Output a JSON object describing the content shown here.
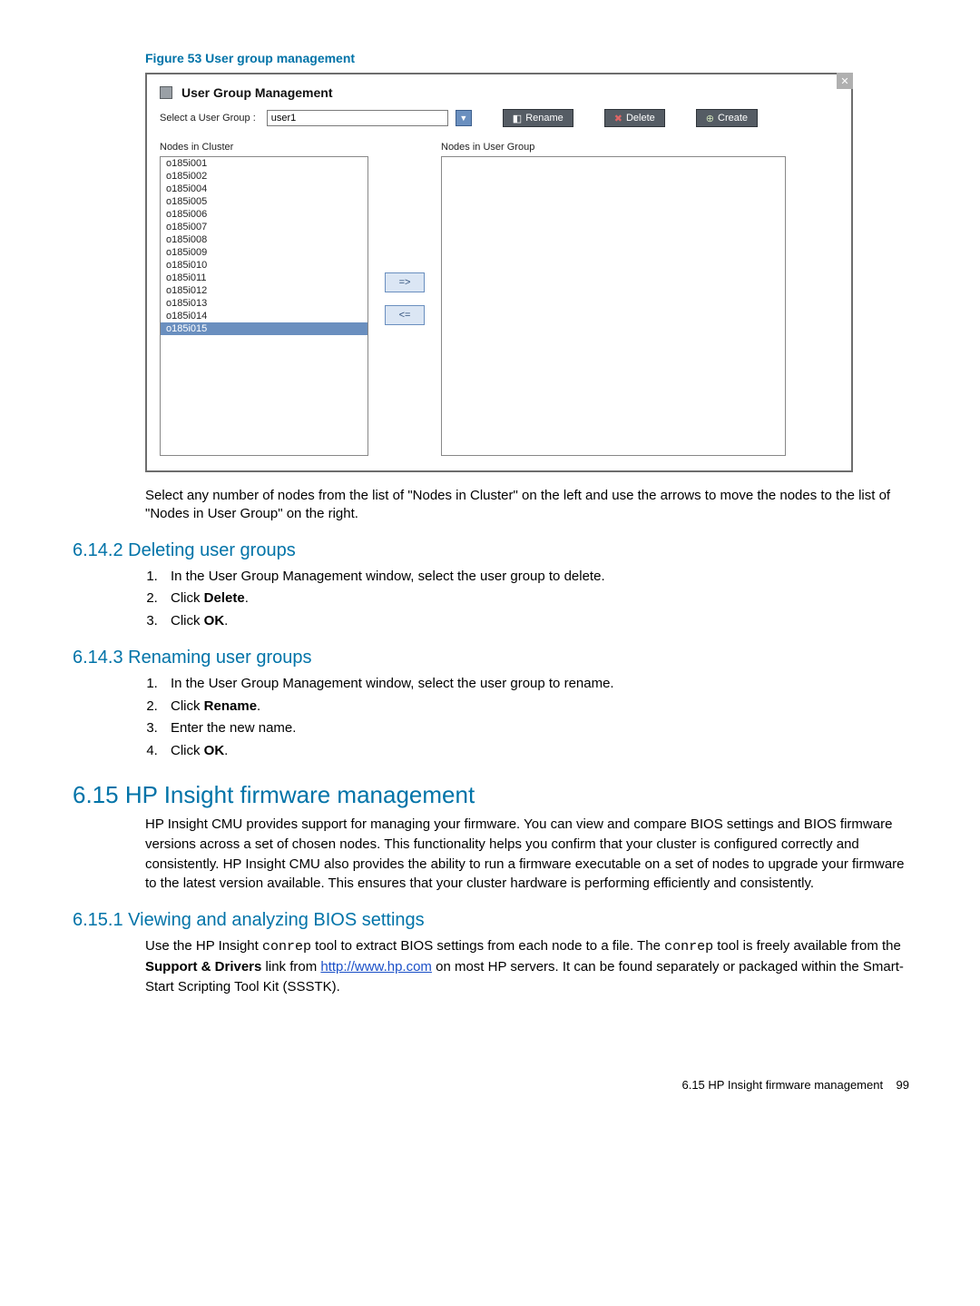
{
  "figure_caption": "Figure 53 User group management",
  "dialog": {
    "title": "User Group Management",
    "close_glyph": "✕",
    "select_label": "Select a User Group :",
    "select_value": "user1",
    "dropdown_arrow": "▼",
    "buttons": {
      "rename": {
        "icon": "◧",
        "label": "Rename"
      },
      "delete": {
        "icon": "✖",
        "label": "Delete"
      },
      "create": {
        "icon": "⊕",
        "label": "Create"
      }
    },
    "left_label": "Nodes in Cluster",
    "right_label": "Nodes in User Group",
    "nodes": [
      "o185i001",
      "o185i002",
      "o185i004",
      "o185i005",
      "o185i006",
      "o185i007",
      "o185i008",
      "o185i009",
      "o185i010",
      "o185i011",
      "o185i012",
      "o185i013",
      "o185i014",
      "o185i015"
    ],
    "selected_index": 13,
    "arrow_right": "=>",
    "arrow_left": "<="
  },
  "after_figure_text": "Select any number of nodes from the list of \"Nodes in Cluster\" on the left and use the arrows to move the nodes to the list of \"Nodes in User Group\" on the right.",
  "sections": {
    "deleting": {
      "heading": "6.14.2 Deleting user groups",
      "steps": [
        "In the User Group Management window, select the user group to delete.",
        "Click <b>Delete</b>.",
        "Click <b>OK</b>."
      ]
    },
    "renaming": {
      "heading": "6.14.3 Renaming user groups",
      "steps": [
        "In the User Group Management window, select the user group to rename.",
        "Click <b>Rename</b>.",
        "Enter the new name.",
        "Click <b>OK</b>."
      ]
    },
    "firmware": {
      "heading": "6.15 HP Insight firmware management",
      "para": "HP Insight CMU provides support for managing your firmware. You can view and compare BIOS settings and BIOS firmware versions across a set of chosen nodes. This functionality helps you confirm that your cluster is configured correctly and consistently. HP Insight CMU also provides the ability to run a firmware executable on a set of nodes to upgrade your firmware to the latest version available. This ensures that your cluster hardware is performing efficiently and consistently."
    },
    "bios": {
      "heading": "6.15.1 Viewing and analyzing BIOS settings",
      "para_pre": "Use the HP Insight ",
      "conrep1": "conrep",
      "para_mid1": " tool to extract BIOS settings from each node to a file. The ",
      "conrep2": "conrep",
      "para_mid2": " tool is freely available from the ",
      "support_bold": "Support & Drivers",
      "para_mid3": " link from ",
      "link_text": "http://www.hp.com",
      "para_end": " on most HP servers. It can be found separately or packaged within the Smart-Start Scripting Tool Kit (SSSTK)."
    }
  },
  "footer": {
    "text": "6.15 HP Insight firmware management",
    "page": "99"
  }
}
